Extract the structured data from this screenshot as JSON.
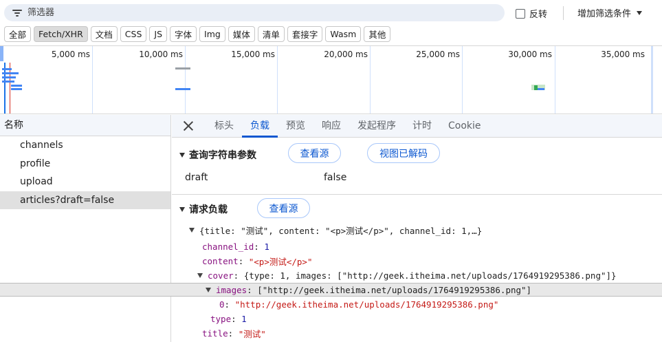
{
  "filter": {
    "placeholder": "筛选器",
    "invert_label": "反转",
    "add_filter_label": "增加筛选条件"
  },
  "type_chips": [
    {
      "label": "全部",
      "active": false
    },
    {
      "label": "Fetch/XHR",
      "active": true
    },
    {
      "label": "文档",
      "active": false
    },
    {
      "label": "CSS",
      "active": false
    },
    {
      "label": "JS",
      "active": false
    },
    {
      "label": "字体",
      "active": false
    },
    {
      "label": "Img",
      "active": false
    },
    {
      "label": "媒体",
      "active": false
    },
    {
      "label": "清单",
      "active": false
    },
    {
      "label": "套接字",
      "active": false
    },
    {
      "label": "Wasm",
      "active": false
    },
    {
      "label": "其他",
      "active": false
    }
  ],
  "timeline": {
    "ticks": [
      "5,000 ms",
      "10,000 ms",
      "15,000 ms",
      "20,000 ms",
      "25,000 ms",
      "30,000 ms",
      "35,000 ms"
    ]
  },
  "request_list": {
    "column_header": "名称",
    "rows": [
      {
        "name": "channels",
        "selected": false
      },
      {
        "name": "profile",
        "selected": false
      },
      {
        "name": "upload",
        "selected": false
      },
      {
        "name": "articles?draft=false",
        "selected": true
      }
    ]
  },
  "detail_tabs": [
    {
      "label": "标头",
      "active": false
    },
    {
      "label": "负载",
      "active": true
    },
    {
      "label": "预览",
      "active": false
    },
    {
      "label": "响应",
      "active": false
    },
    {
      "label": "发起程序",
      "active": false
    },
    {
      "label": "计时",
      "active": false
    },
    {
      "label": "Cookie",
      "active": false
    }
  ],
  "query_params": {
    "title": "查询字符串参数",
    "view_source": "查看源",
    "view_decoded": "视图已解码",
    "key": "draft",
    "value": "false"
  },
  "request_payload": {
    "title": "请求负载",
    "view_source": "查看源",
    "summary": "{title: \"测试\", content: \"<p>测试</p>\", channel_id: 1,…}",
    "channel_id_key": "channel_id",
    "channel_id_value": "1",
    "content_key": "content",
    "content_value": "\"<p>测试</p>\"",
    "cover_key": "cover",
    "cover_summary": "{type: 1, images: [\"http://geek.itheima.net/uploads/1764919295386.png\"]}",
    "images_key": "images",
    "images_summary": "[\"http://geek.itheima.net/uploads/1764919295386.png\"]",
    "image0_key": "0",
    "image0_value": "\"http://geek.itheima.net/uploads/1764919295386.png\"",
    "type_key": "type",
    "type_value": "1",
    "title_key": "title",
    "title_value": "\"测试\""
  },
  "colors": {
    "accent": "#0b57d0",
    "json_key": "#881280",
    "json_number": "#1a1aa6",
    "json_string": "#c41a16"
  }
}
